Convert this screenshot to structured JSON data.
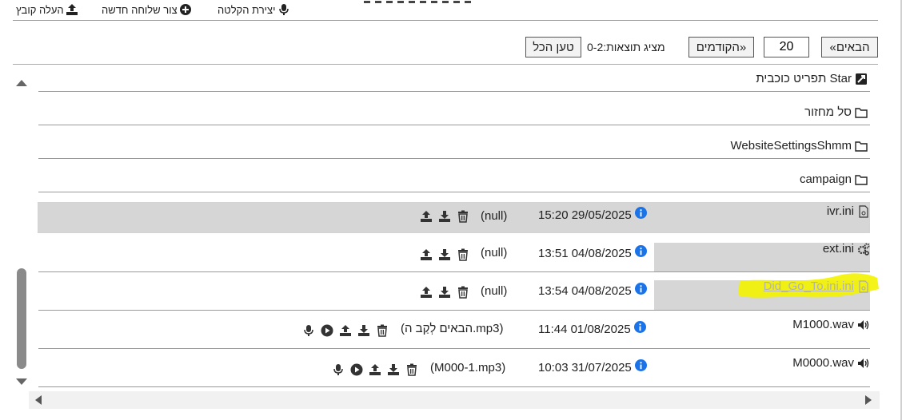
{
  "toolbar": {
    "upload_label": "העלה קובץ",
    "new_extension_label": "צור שלוחה חדשה",
    "recording_label": "יצירת הקלטה"
  },
  "pager": {
    "next_label": "«הבאים",
    "page_size": "20",
    "prev_label": "הקודמים»",
    "showing_label": "מציג תוצאות:0-2",
    "load_all_label": "טען הכל"
  },
  "folders": [
    {
      "name": "Star תפריט כוכבית",
      "icon": "star-menu-icon"
    },
    {
      "name": "סל מחזור",
      "icon": "folder-icon"
    },
    {
      "name": "WebsiteSettingsShmm",
      "icon": "folder-icon"
    },
    {
      "name": "campaign",
      "icon": "folder-icon"
    }
  ],
  "files": [
    {
      "name": "ivr.ini",
      "icon": "ini-file-icon",
      "date": "15:20 29/05/2025",
      "comment": "(null)",
      "selected": true,
      "highlighted": false,
      "audio": false
    },
    {
      "name": "ext.ini",
      "icon": "gears-icon",
      "date": "13:51 04/08/2025",
      "comment": "(null)",
      "selected": false,
      "highlighted": false,
      "audio": false
    },
    {
      "name": "Did_Go_To.ini.ini",
      "icon": "ini-file-icon",
      "date": "13:54 04/08/2025",
      "comment": "(null)",
      "selected": false,
      "highlighted": true,
      "audio": false
    },
    {
      "name": "M1000.wav",
      "icon": "speaker-icon",
      "date": "11:44 01/08/2025",
      "comment": "(הבאים לְקַב ה.mp3)",
      "selected": false,
      "highlighted": false,
      "audio": true
    },
    {
      "name": "M0000.wav",
      "icon": "speaker-icon",
      "date": "10:03 31/07/2025",
      "comment": "(M000-1.mp3)",
      "selected": false,
      "highlighted": false,
      "audio": true
    }
  ],
  "colors": {
    "info_blue": "#1a73e8",
    "row_grey": "#d6d6d6",
    "selected_border": "#a8e6ea",
    "highlight_yellow": "#f3f300"
  }
}
